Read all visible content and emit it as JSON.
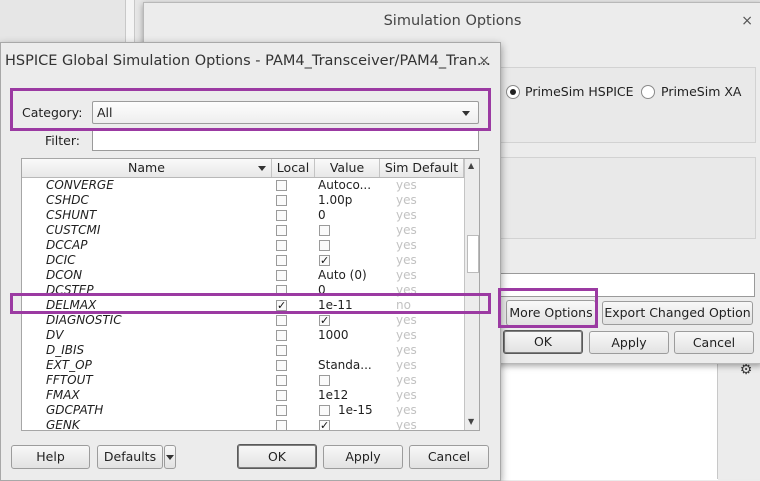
{
  "sim_options": {
    "title": "Simulation Options",
    "close": "×",
    "radio_hspice": "PrimeSim HSPICE",
    "radio_xa": "PrimeSim XA",
    "more_options": "More Options",
    "export_changed": "Export Changed Option",
    "ok": "OK",
    "apply": "Apply",
    "cancel": "Cancel"
  },
  "hspice": {
    "title": "HSPICE Global Simulation Options - PAM4_Transceiver/PAM4_Tran...",
    "close": "×",
    "category_label": "Category:",
    "category_value": "All",
    "filter_label": "Filter:",
    "filter_value": "",
    "columns": [
      "Name",
      "Local",
      "Value",
      "Sim Default"
    ],
    "rows": [
      {
        "name": "CONVERGE",
        "local": "",
        "value": "Autoco...",
        "value_checkbox": "",
        "default": "yes"
      },
      {
        "name": "CSHDC",
        "local": "",
        "value": "1.00p",
        "value_checkbox": "",
        "default": "yes"
      },
      {
        "name": "CSHUNT",
        "local": "",
        "value": "0",
        "value_checkbox": "",
        "default": "yes"
      },
      {
        "name": "CUSTCMI",
        "local": "",
        "value": "",
        "value_checkbox": "☐",
        "default": "yes"
      },
      {
        "name": "DCCAP",
        "local": "",
        "value": "",
        "value_checkbox": "☐",
        "default": "yes"
      },
      {
        "name": "DCIC",
        "local": "",
        "value": "",
        "value_checkbox": "✓",
        "default": "yes"
      },
      {
        "name": "DCON",
        "local": "",
        "value": "Auto (0)",
        "value_checkbox": "",
        "default": "yes"
      },
      {
        "name": "DCSTEP",
        "local": "",
        "value": "0",
        "value_checkbox": "",
        "default": "yes"
      },
      {
        "name": "DELMAX",
        "local": "✓",
        "value": "1e-11",
        "value_checkbox": "",
        "default": "no"
      },
      {
        "name": "DIAGNOSTIC",
        "local": "",
        "value": "",
        "value_checkbox": "✓",
        "default": "yes"
      },
      {
        "name": "DV",
        "local": "",
        "value": "1000",
        "value_checkbox": "",
        "default": "yes"
      },
      {
        "name": "D_IBIS",
        "local": "",
        "value": "",
        "value_checkbox": "",
        "default": "yes"
      },
      {
        "name": "EXT_OP",
        "local": "",
        "value": "Standa...",
        "value_checkbox": "",
        "default": "yes"
      },
      {
        "name": "FFTOUT",
        "local": "",
        "value": "",
        "value_checkbox": "☐",
        "default": "yes"
      },
      {
        "name": "FMAX",
        "local": "",
        "value": "1e12",
        "value_checkbox": "",
        "default": "yes"
      },
      {
        "name": "GDCPATH",
        "local": "",
        "value": "1e-15",
        "value_checkbox": "☐",
        "default": "yes"
      },
      {
        "name": "GENK",
        "local": "",
        "value": "",
        "value_checkbox": "✓",
        "default": "yes"
      }
    ],
    "help": "Help",
    "defaults": "Defaults",
    "ok": "OK",
    "apply": "Apply",
    "cancel": "Cancel"
  },
  "colors": {
    "highlight": "#9b3aa2"
  }
}
